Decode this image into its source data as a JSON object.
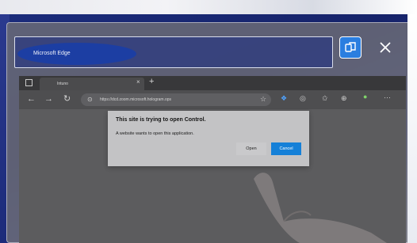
{
  "window": {
    "title": "Microsoft Edge",
    "snap_icon": "snap-layout-icon",
    "close_icon": "close-icon"
  },
  "browser": {
    "tab": {
      "title": "Intuno",
      "close": "×"
    },
    "new_tab": "+",
    "address": "https://dcd.zoom.microsoft.hologram.ops",
    "icons": [
      "back-icon",
      "forward-icon",
      "refresh-icon",
      "lock-icon",
      "read-aloud-icon",
      "favorite-icon",
      "extension-icon",
      "collections-icon",
      "sync-icon",
      "profile-icon",
      "more-icon"
    ]
  },
  "dialog": {
    "title": "This site is trying to open Control.",
    "message": "A website wants to open this application.",
    "open_label": "Open",
    "cancel_label": "Cancel"
  },
  "colors": {
    "accent_blue": "#1580d8",
    "title_pill": "#1c3ea3",
    "backdrop": "#1c2d7d"
  }
}
